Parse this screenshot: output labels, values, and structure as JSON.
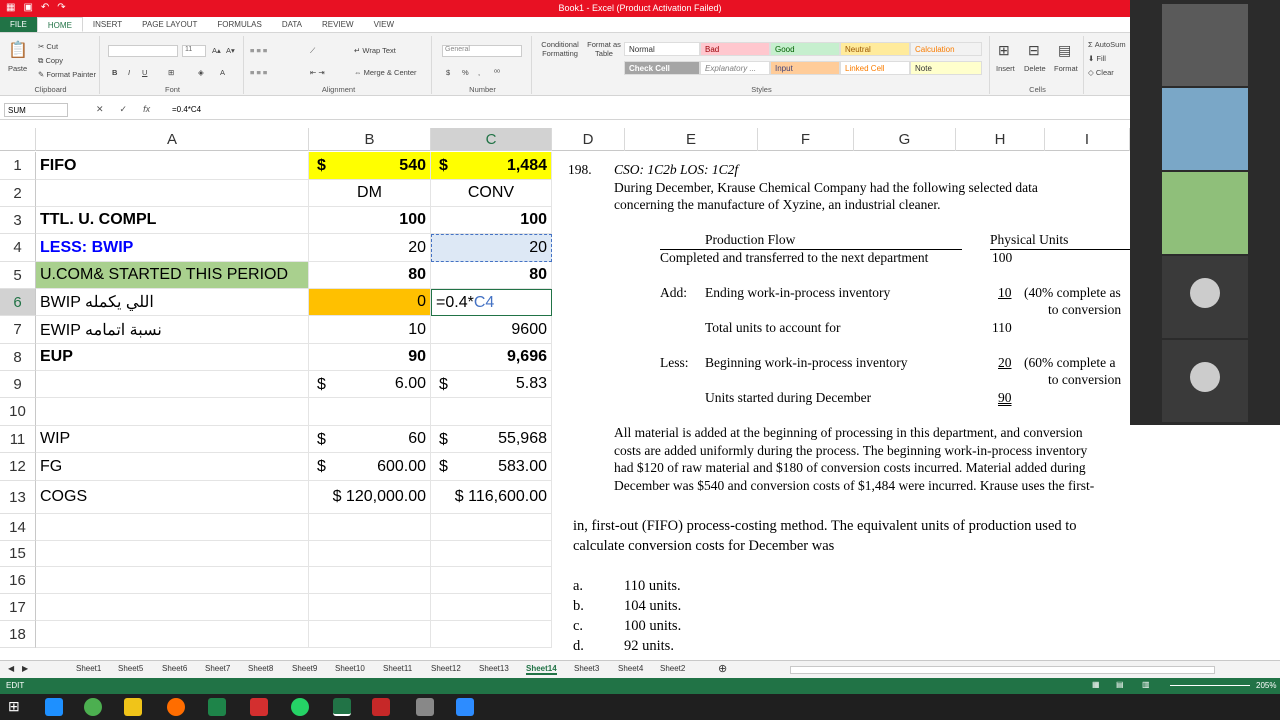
{
  "title_bar": {
    "title": "Book1 - Excel (Product Activation Failed)"
  },
  "ribbon_tabs": [
    "FILE",
    "HOME",
    "INSERT",
    "PAGE LAYOUT",
    "FORMULAS",
    "DATA",
    "REVIEW",
    "VIEW"
  ],
  "ribbon": {
    "clipboard": {
      "label": "Clipboard",
      "paste": "Paste",
      "cut": "Cut",
      "copy": "Copy",
      "format_painter": "Format Painter"
    },
    "font": {
      "label": "Font",
      "size": "11",
      "bold": "B",
      "italic": "I",
      "underline": "U"
    },
    "alignment": {
      "label": "Alignment",
      "wrap": "Wrap Text",
      "merge": "Merge & Center"
    },
    "number": {
      "label": "Number",
      "format": "General",
      "currency": "$",
      "percent": "%"
    },
    "styles": {
      "label": "Styles",
      "conditional": "Conditional Formatting",
      "format_table": "Format as Table",
      "normal": "Normal",
      "bad": "Bad",
      "good": "Good",
      "neutral": "Neutral",
      "calculation": "Calculation",
      "check_cell": "Check Cell",
      "explanatory": "Explanatory ...",
      "input": "Input",
      "linked_cell": "Linked Cell",
      "note": "Note"
    },
    "cells": {
      "label": "Cells",
      "insert": "Insert",
      "delete": "Delete",
      "format": "Format"
    },
    "editing": {
      "autosum": "AutoSum",
      "fill": "Fill",
      "clear": "Clear"
    }
  },
  "formula_bar": {
    "name_box": "SUM",
    "formula": "=0.4*C4"
  },
  "columns": [
    "A",
    "B",
    "C",
    "D",
    "E",
    "F",
    "G",
    "H",
    "I"
  ],
  "rows": [
    "1",
    "2",
    "3",
    "4",
    "5",
    "6",
    "7",
    "8",
    "9",
    "10",
    "11",
    "12",
    "13",
    "14",
    "15",
    "16",
    "17",
    "18"
  ],
  "sheet": {
    "r1": {
      "a": "FIFO",
      "b_cur": "$",
      "b": "540",
      "c_cur": "$",
      "c": "1,484"
    },
    "r2": {
      "b": "DM",
      "c": "CONV"
    },
    "r3": {
      "a": "TTL. U. COMPL",
      "b": "100",
      "c": "100"
    },
    "r4": {
      "a": "LESS: BWIP",
      "b": "20",
      "c": "20"
    },
    "r5": {
      "a": "U.COM& STARTED THIS PERIOD",
      "b": "80",
      "c": "80"
    },
    "r6": {
      "a": "BWIP اللي يكمله",
      "b": "0",
      "c_edit": "=0.4*",
      "c_ref": "C4"
    },
    "r7": {
      "a": "EWIP نسبة اتمامه",
      "b": "10",
      "c": "9600"
    },
    "r8": {
      "a": "EUP",
      "b": "90",
      "c": "9,696"
    },
    "r9": {
      "b_cur": "$",
      "b": "6.00",
      "c_cur": "$",
      "c": "5.83"
    },
    "r11": {
      "a": "WIP",
      "b_cur": "$",
      "b": "60",
      "c_cur": "$",
      "c": "55,968"
    },
    "r12": {
      "a": "FG",
      "b_cur": "$",
      "b": "600.00",
      "c_cur": "$",
      "c": "583.00"
    },
    "r13": {
      "a": "COGS",
      "b": "$ 120,000.00",
      "c": "$ 116,600.00"
    }
  },
  "doc": {
    "qnum": "198.",
    "cso": "CSO: 1C2b     LOS: 1C2f",
    "intro1": "During December, Krause Chemical Company had the following selected data",
    "intro2": "concerning the manufacture of Xyzine, an industrial cleaner.",
    "h_flow": "Production Flow",
    "h_units": "Physical Units",
    "l1": "Completed and transferred to the next department",
    "v1": "100",
    "add": "Add:",
    "l2": "Ending work-in-process inventory",
    "v2": "10",
    "n2a": "(40% complete as",
    "n2b": "to conversion",
    "l3": "Total units to account for",
    "v3": "110",
    "less": "Less:",
    "l4": "Beginning work-in-process inventory",
    "v4": "20",
    "n4a": "(60% complete a",
    "n4b": "to conversion",
    "l5": "Units started during December",
    "v5": "90",
    "p1": "All material is added at the beginning of processing in this department, and conversion",
    "p2": "costs are added uniformly during the process.  The beginning work-in-process inventory",
    "p3": "had $120 of raw material and $180 of conversion costs incurred.  Material added during",
    "p4": "December was $540 and conversion costs of $1,484 were incurred.  Krause uses the first-",
    "p5": "in, first-out (FIFO) process-costing method.  The equivalent units of production used to",
    "p6": "calculate conversion costs for December was",
    "opts": [
      {
        "k": "a.",
        "t": "110 units."
      },
      {
        "k": "b.",
        "t": "104 units."
      },
      {
        "k": "c.",
        "t": "100 units."
      },
      {
        "k": "d.",
        "t": "92 units."
      }
    ]
  },
  "sheet_tabs": [
    "Sheet1",
    "Sheet5",
    "Sheet6",
    "Sheet7",
    "Sheet8",
    "Sheet9",
    "Sheet10",
    "Sheet11",
    "Sheet12",
    "Sheet13",
    "Sheet14",
    "Sheet3",
    "Sheet4",
    "Sheet2"
  ],
  "active_sheet": "Sheet14",
  "status": {
    "mode": "EDIT",
    "zoom": "205%"
  },
  "colors": {
    "excel_green": "#217346",
    "title_red": "#e81123",
    "yellow": "#ffff00",
    "green_fill": "#a9d08e",
    "orange_fill": "#ffc000",
    "blue_text": "#0000ff"
  }
}
